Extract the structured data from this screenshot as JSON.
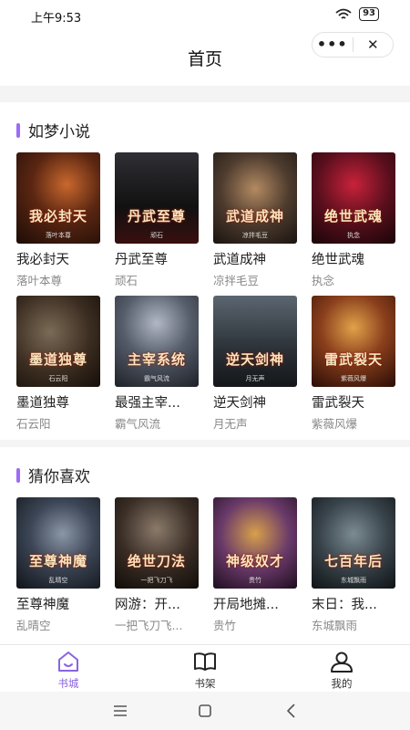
{
  "status": {
    "time": "上午9:53",
    "battery": "93"
  },
  "header": {
    "title": "首页"
  },
  "sections": [
    {
      "title": "如梦小说",
      "books": [
        {
          "title": "我必封天",
          "author": "落叶本尊",
          "cover_text": "我必封天",
          "cover_author": "落叶本尊"
        },
        {
          "title": "丹武至尊",
          "author": "顽石",
          "cover_text": "丹武至尊",
          "cover_author": "顽石"
        },
        {
          "title": "武道成神",
          "author": "凉拌毛豆",
          "cover_text": "武道成神",
          "cover_author": "凉拌毛豆"
        },
        {
          "title": "绝世武魂",
          "author": "执念",
          "cover_text": "绝世武魂",
          "cover_author": "执念"
        },
        {
          "title": "墨道独尊",
          "author": "石云阳",
          "cover_text": "墨道独尊",
          "cover_author": "石云阳"
        },
        {
          "title": "最强主宰...",
          "author": "霸气风流",
          "cover_text": "主宰系统",
          "cover_author": "霸气风流"
        },
        {
          "title": "逆天剑神",
          "author": "月无声",
          "cover_text": "逆天剑神",
          "cover_author": "月无声"
        },
        {
          "title": "雷武裂天",
          "author": "紫薇风爆",
          "cover_text": "雷武裂天",
          "cover_author": "紫薇风爆"
        }
      ]
    },
    {
      "title": "猜你喜欢",
      "books": [
        {
          "title": "至尊神魔",
          "author": "乱晴空",
          "cover_text": "至尊神魔",
          "cover_author": "乱晴空"
        },
        {
          "title": "网游：开...",
          "author": "一把飞刀飞...",
          "cover_text": "绝世刀法",
          "cover_author": "一把飞刀飞"
        },
        {
          "title": "开局地摊...",
          "author": "贵竹",
          "cover_text": "神级奴才",
          "cover_author": "贵竹"
        },
        {
          "title": "末日：我...",
          "author": "东城飘雨",
          "cover_text": "七百年后",
          "cover_author": "东城飘雨"
        }
      ]
    }
  ],
  "tabs": [
    {
      "label": "书城",
      "icon": "store-icon",
      "active": true
    },
    {
      "label": "书架",
      "icon": "bookshelf-icon",
      "active": false
    },
    {
      "label": "我的",
      "icon": "user-icon",
      "active": false
    }
  ],
  "colors": {
    "accent": "#8a63e0",
    "section_bar": "#9b6cf5"
  }
}
